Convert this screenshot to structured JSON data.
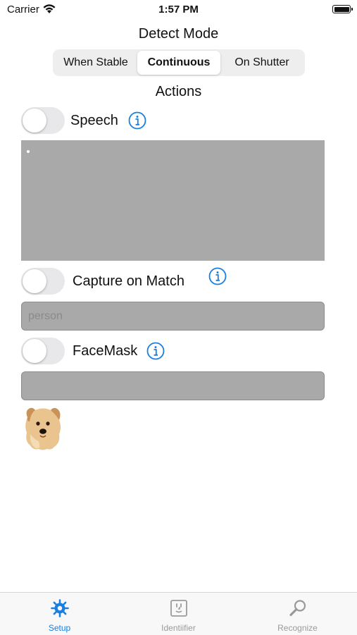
{
  "status_bar": {
    "carrier": "Carrier",
    "time": "1:57 PM"
  },
  "detect_mode": {
    "title": "Detect Mode",
    "options": [
      "When Stable",
      "Continuous",
      "On Shutter"
    ],
    "selected": "Continuous"
  },
  "actions": {
    "title": "Actions",
    "speech": {
      "label": "Speech",
      "enabled": false,
      "text": ""
    },
    "capture_on_match": {
      "label": "Capture on Match",
      "enabled": false,
      "placeholder": "person",
      "value": ""
    },
    "facemask": {
      "label": "FaceMask",
      "enabled": false,
      "value": ""
    }
  },
  "tab_bar": {
    "items": [
      {
        "label": "Setup",
        "icon": "gear-icon",
        "selected": true
      },
      {
        "label": "Identiifier",
        "icon": "face-id-icon",
        "selected": false
      },
      {
        "label": "Recognize",
        "icon": "magnifier-icon",
        "selected": false
      }
    ]
  },
  "colors": {
    "accent": "#1a7fe0",
    "inactive": "#9a9a9a",
    "field_bg": "#a9a9a9"
  }
}
